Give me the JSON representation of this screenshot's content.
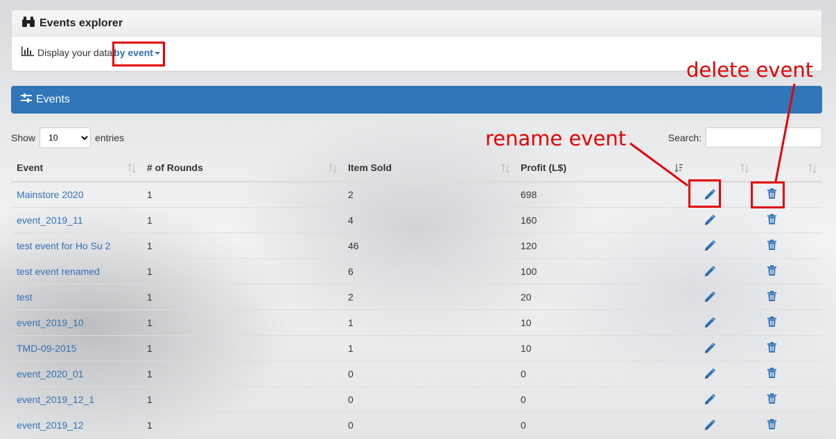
{
  "explorer": {
    "title": "Events explorer",
    "display_label": "Display your data",
    "mode_value": "by event"
  },
  "events_panel": {
    "title": "Events"
  },
  "controls": {
    "show_label": "Show",
    "entries_value": "10",
    "entries_label": "entries",
    "search_label": "Search:"
  },
  "table": {
    "columns": [
      "Event",
      "# of Rounds",
      "Item Sold",
      "Profit (L$)",
      "",
      ""
    ],
    "rows": [
      {
        "event": "Mainstore 2020",
        "rounds": "1",
        "sold": "2",
        "profit": "698"
      },
      {
        "event": "event_2019_11",
        "rounds": "1",
        "sold": "4",
        "profit": "160"
      },
      {
        "event": "test event for Ho Su 2",
        "rounds": "1",
        "sold": "46",
        "profit": "120"
      },
      {
        "event": "test event renamed",
        "rounds": "1",
        "sold": "6",
        "profit": "100"
      },
      {
        "event": "test",
        "rounds": "1",
        "sold": "2",
        "profit": "20"
      },
      {
        "event": "event_2019_10",
        "rounds": "1",
        "sold": "1",
        "profit": "10"
      },
      {
        "event": "TMD-09-2015",
        "rounds": "1",
        "sold": "1",
        "profit": "10"
      },
      {
        "event": "event_2020_01",
        "rounds": "1",
        "sold": "0",
        "profit": "0"
      },
      {
        "event": "event_2019_12_1",
        "rounds": "1",
        "sold": "0",
        "profit": "0"
      },
      {
        "event": "event_2019_12",
        "rounds": "1",
        "sold": "0",
        "profit": "0"
      }
    ]
  },
  "annotations": {
    "rename": "rename event",
    "delete": "delete event"
  },
  "colors": {
    "accent": "#3076b8",
    "link": "#2f71b5",
    "annotation": "#e30000"
  },
  "icons": [
    "binoculars-icon",
    "bar-chart-icon",
    "sliders-icon",
    "pencil-icon",
    "trash-icon",
    "sort-icon"
  ]
}
